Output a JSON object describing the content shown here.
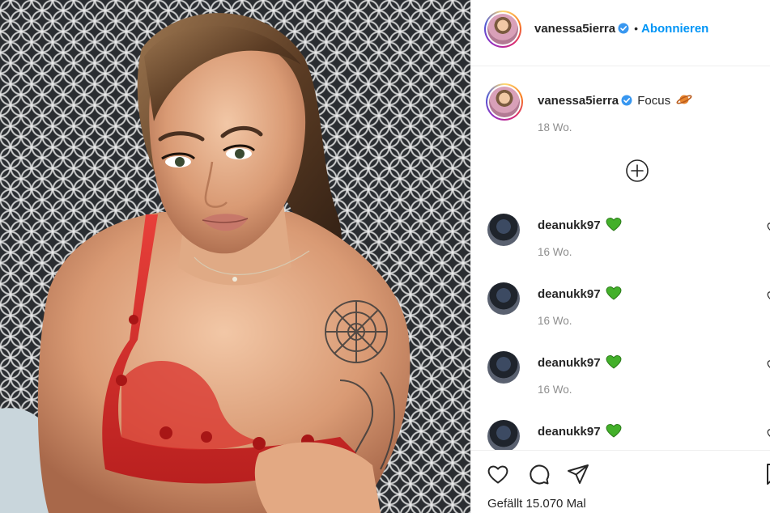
{
  "post_author": {
    "username": "vanessa5ierra",
    "verified": true,
    "separator": "•",
    "follow_label": "Abonnieren"
  },
  "caption": {
    "username": "vanessa5ierra",
    "text": "Focus",
    "emoji_icon": "ringed-planet-icon",
    "time_ago": "18 Wo."
  },
  "load_more_icon": "plus-circle-icon",
  "comments": [
    {
      "username": "deanukk97",
      "emoji_icon": "green-heart-icon",
      "time_ago": "16 Wo."
    },
    {
      "username": "deanukk97",
      "emoji_icon": "green-heart-icon",
      "time_ago": "16 Wo."
    },
    {
      "username": "deanukk97",
      "emoji_icon": "green-heart-icon",
      "time_ago": "16 Wo."
    },
    {
      "username": "deanukk97",
      "emoji_icon": "green-heart-icon",
      "time_ago": ""
    }
  ],
  "actions": {
    "icons": [
      "heart-icon",
      "comment-icon",
      "share-icon",
      "bookmark-icon"
    ],
    "likes_text": "Gefällt 15.070 Mal"
  },
  "colors": {
    "accent": "#0095f6",
    "verified_badge": "#3897f0",
    "green_heart": "#43b02a",
    "text": "#262626",
    "muted": "#8e8e8e",
    "divider": "#efefef"
  }
}
